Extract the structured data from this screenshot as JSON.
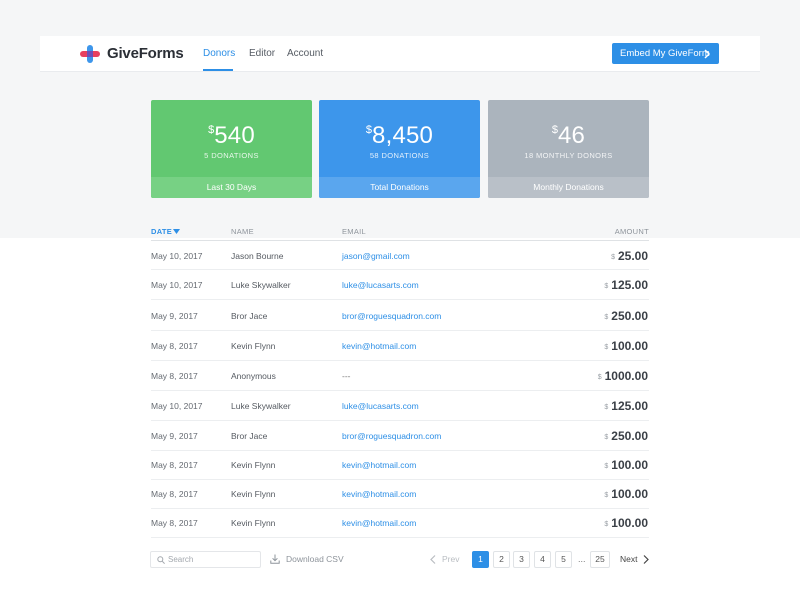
{
  "brand": {
    "name": "GiveForms"
  },
  "nav": {
    "tabs": [
      {
        "label": "Donors"
      },
      {
        "label": "Editor"
      },
      {
        "label": "Account"
      }
    ],
    "embed_button": "Embed My GiveForm"
  },
  "stats": [
    {
      "currency": "$",
      "value": "540",
      "sub": "5 DONATIONS",
      "foot": "Last 30 Days"
    },
    {
      "currency": "$",
      "value": "8,450",
      "sub": "58 DONATIONS",
      "foot": "Total Donations"
    },
    {
      "currency": "$",
      "value": "46",
      "sub": "18 MONTHLY DONORS",
      "foot": "Monthly Donations"
    }
  ],
  "table": {
    "headers": {
      "date": "DATE",
      "name": "NAME",
      "email": "EMAIL",
      "amount": "AMOUNT"
    },
    "currency": "$",
    "rows": [
      {
        "date": "May 10, 2017",
        "name": "Jason Bourne",
        "email": "jason@gmail.com",
        "amount": "25.00"
      },
      {
        "date": "May 10, 2017",
        "name": "Luke Skywalker",
        "email": "luke@lucasarts.com",
        "amount": "125.00"
      },
      {
        "date": "May 9, 2017",
        "name": "Bror Jace",
        "email": "bror@roguesquadron.com",
        "amount": "250.00"
      },
      {
        "date": "May 8, 2017",
        "name": "Kevin Flynn",
        "email": "kevin@hotmail.com",
        "amount": "100.00"
      },
      {
        "date": "May 8, 2017",
        "name": "Anonymous",
        "email": "---",
        "amount": "1000.00"
      },
      {
        "date": "May 10, 2017",
        "name": "Luke Skywalker",
        "email": "luke@lucasarts.com",
        "amount": "125.00"
      },
      {
        "date": "May 9, 2017",
        "name": "Bror Jace",
        "email": "bror@roguesquadron.com",
        "amount": "250.00"
      },
      {
        "date": "May 8, 2017",
        "name": "Kevin Flynn",
        "email": "kevin@hotmail.com",
        "amount": "100.00"
      },
      {
        "date": "May 8, 2017",
        "name": "Kevin Flynn",
        "email": "kevin@hotmail.com",
        "amount": "100.00"
      },
      {
        "date": "May 8, 2017",
        "name": "Kevin Flynn",
        "email": "kevin@hotmail.com",
        "amount": "100.00"
      }
    ]
  },
  "footer": {
    "search_placeholder": "Search",
    "download_label": "Download CSV",
    "prev_label": "Prev",
    "next_label": "Next",
    "pages": [
      "1",
      "2",
      "3",
      "4",
      "5"
    ],
    "ellipsis": "...",
    "last_page": "25",
    "current_page": "1"
  },
  "colors": {
    "accent": "#2d8fe6",
    "green": "#62c871",
    "blue": "#3d96eb",
    "gray": "#abb4bd"
  },
  "icons": [
    "giveforms-logo-icon",
    "chevron-right-icon",
    "sort-caret-down-icon",
    "search-icon",
    "download-icon",
    "chevron-left-icon"
  ]
}
